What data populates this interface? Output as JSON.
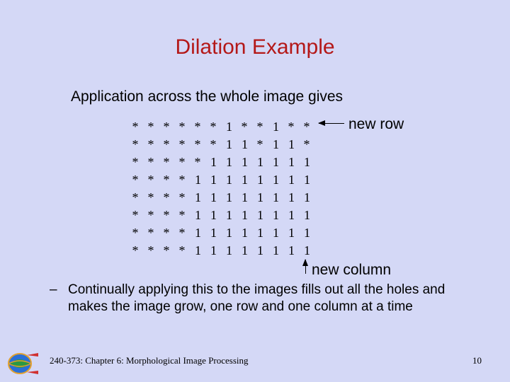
{
  "title": "Dilation Example",
  "subtitle": "Application across the whole image gives",
  "new_row_label": "new row",
  "new_col_label": "new column",
  "bullet_dash": "–",
  "bullet_text": "Continually applying this to the images fills out all the holes and makes the image grow, one row and one column at a time",
  "footer_left": "240-373: Chapter 6: Morphological Image Processing",
  "footer_right": "10",
  "grid": [
    [
      "*",
      "*",
      "*",
      "*",
      "*",
      "*",
      "1",
      "*",
      "*",
      "1",
      "*",
      "*"
    ],
    [
      "*",
      "*",
      "*",
      "*",
      "*",
      "*",
      "1",
      "1",
      "*",
      "1",
      "1",
      "*"
    ],
    [
      "*",
      "*",
      "*",
      "*",
      "*",
      "1",
      "1",
      "1",
      "1",
      "1",
      "1",
      "1"
    ],
    [
      "*",
      "*",
      "*",
      "*",
      "1",
      "1",
      "1",
      "1",
      "1",
      "1",
      "1",
      "1"
    ],
    [
      "*",
      "*",
      "*",
      "*",
      "1",
      "1",
      "1",
      "1",
      "1",
      "1",
      "1",
      "1"
    ],
    [
      "*",
      "*",
      "*",
      "*",
      "1",
      "1",
      "1",
      "1",
      "1",
      "1",
      "1",
      "1"
    ],
    [
      "*",
      "*",
      "*",
      "*",
      "1",
      "1",
      "1",
      "1",
      "1",
      "1",
      "1",
      "1"
    ],
    [
      "*",
      "*",
      "*",
      "*",
      "1",
      "1",
      "1",
      "1",
      "1",
      "1",
      "1",
      "1"
    ]
  ]
}
